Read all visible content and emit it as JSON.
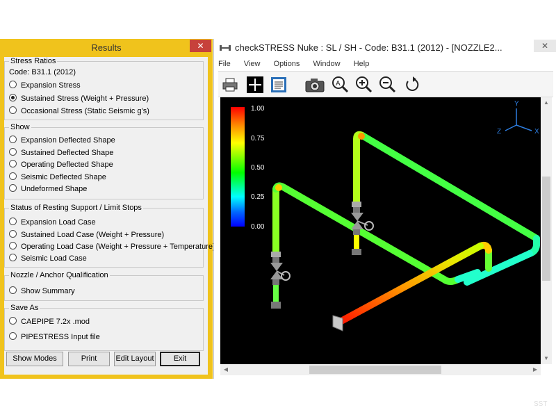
{
  "results": {
    "title": "Results",
    "close_glyph": "✕",
    "groups": {
      "stress_ratios": {
        "title": "Stress Ratios",
        "code": "Code: B31.1 (2012)",
        "options": [
          "Expansion Stress",
          "Sustained Stress (Weight + Pressure)",
          "Occasional Stress (Static Seismic g's)"
        ],
        "selected": 1
      },
      "show": {
        "title": "Show",
        "options": [
          "Expansion Deflected Shape",
          "Sustained Deflected Shape",
          "Operating Deflected Shape",
          "Seismic Deflected Shape",
          "Undeformed Shape"
        ]
      },
      "resting_support": {
        "title": "Status of Resting Support / Limit Stops",
        "options": [
          "Expansion Load Case",
          "Sustained Load Case (Weight + Pressure)",
          "Operating Load Case (Weight + Pressure + Temperature)",
          "Seismic Load Case"
        ]
      },
      "nozzle": {
        "title": "Nozzle / Anchor Qualification",
        "options": [
          "Show Summary"
        ]
      },
      "save_as": {
        "title": "Save As",
        "options": [
          "CAEPIPE 7.2x .mod",
          "PIPESTRESS Input file"
        ]
      }
    },
    "buttons": {
      "show_modes": "Show Modes",
      "print": "Print",
      "edit_layout": "Edit Layout",
      "exit": "Exit"
    }
  },
  "app": {
    "title": "checkSTRESS Nuke : SL / SH - Code: B31.1 (2012) -  [NOZZLE2...",
    "close_glyph": "✕",
    "menu": [
      "File",
      "View",
      "Options",
      "Window",
      "Help"
    ],
    "toolbar_icons": [
      "printer-icon",
      "crosshair-icon",
      "document-icon",
      "camera-icon",
      "zoom-all-icon",
      "zoom-in-icon",
      "zoom-out-icon",
      "rotate-icon"
    ],
    "colorbar": {
      "labels": [
        "1.00",
        "0.75",
        "0.50",
        "0.25",
        "0.00"
      ]
    },
    "axes": {
      "x": "X",
      "y": "Y",
      "z": "Z"
    }
  },
  "watermark": "SST",
  "colors": {
    "results_frame": "#f0c31c",
    "close_red": "#c7413b",
    "viewport_bg": "#000000"
  }
}
